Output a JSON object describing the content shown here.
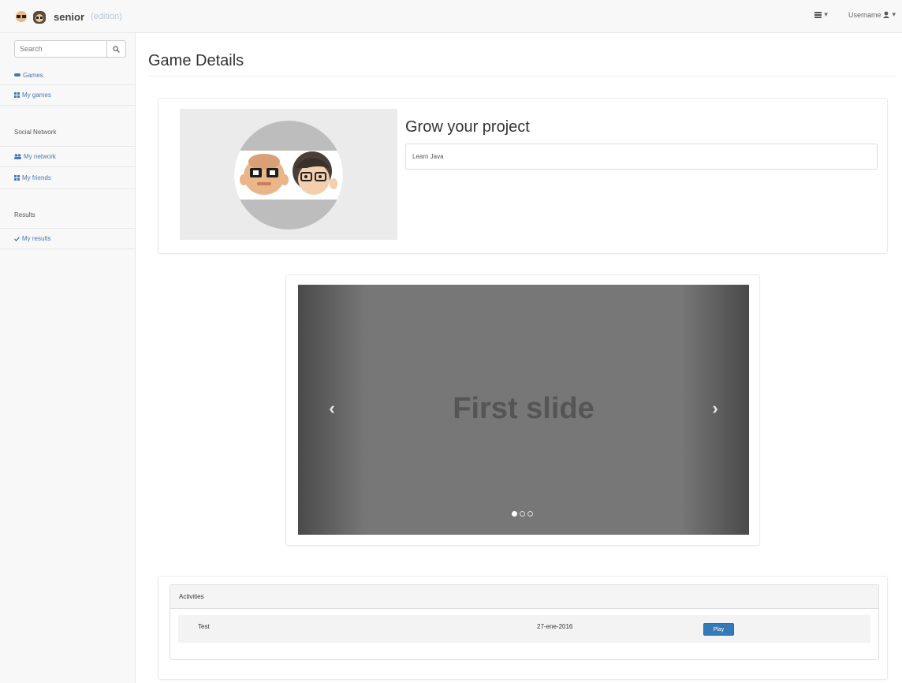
{
  "navbar": {
    "brand_name": "senior",
    "brand_sub": "(edition)",
    "right_menu_caret": "▾",
    "user_label": "Username"
  },
  "sidebar": {
    "search_placeholder": "Search",
    "items": [
      {
        "label": "Games",
        "icon": "gamepad-icon",
        "type": "link"
      },
      {
        "label": "My games",
        "icon": "grid-icon",
        "type": "link"
      },
      {
        "label": "Social Network",
        "type": "header"
      },
      {
        "label": "My network",
        "icon": "users-icon",
        "type": "link"
      },
      {
        "label": "My friends",
        "icon": "grid-icon",
        "type": "link"
      },
      {
        "label": "Results",
        "type": "header"
      },
      {
        "label": "My results",
        "icon": "check-icon",
        "type": "link"
      }
    ]
  },
  "main": {
    "page_title": "Game Details",
    "project_title": "Grow your project",
    "project_field_value": "Learn Java",
    "carousel": {
      "slide_text": "First slide",
      "prev_glyph": "‹",
      "next_glyph": "›",
      "slide_count": 3,
      "active_index": 0
    },
    "activities": {
      "header": "Activities",
      "rows": [
        {
          "name": "Test",
          "date": "27-ene-2016",
          "button": "Play"
        }
      ]
    }
  },
  "colors": {
    "link": "#4a78b0",
    "primary_button": "#337ab7",
    "carousel_bg": "#777777"
  }
}
